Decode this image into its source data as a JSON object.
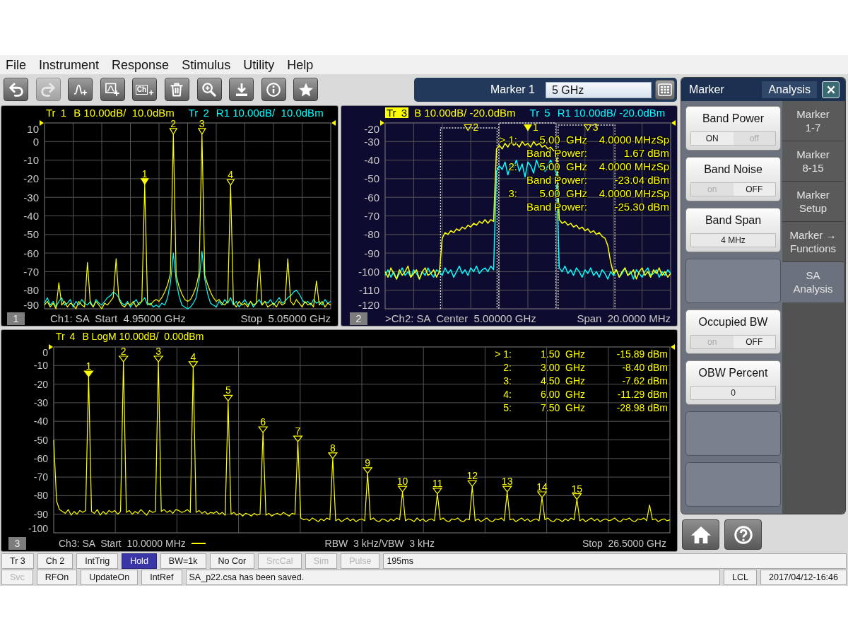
{
  "menu": [
    {
      "label": "File"
    },
    {
      "label": "Instrument"
    },
    {
      "label": "Response"
    },
    {
      "label": "Stimulus"
    },
    {
      "label": "Utility"
    },
    {
      "label": "Help"
    }
  ],
  "toolbar": [
    {
      "kind": "undo",
      "disabled": false
    },
    {
      "kind": "redo",
      "disabled": true
    },
    {
      "kind": "add-trace",
      "disabled": false
    },
    {
      "kind": "add-window",
      "disabled": false
    },
    {
      "kind": "add-channel",
      "text": "Ch",
      "disabled": false
    },
    {
      "kind": "delete",
      "disabled": false
    },
    {
      "kind": "zoom",
      "disabled": false
    },
    {
      "kind": "save",
      "disabled": false
    },
    {
      "kind": "info",
      "disabled": false
    },
    {
      "kind": "favorite",
      "disabled": false
    }
  ],
  "marker_entry": {
    "label": "Marker 1",
    "value": "5 GHz"
  },
  "windows": [
    {
      "number": "1",
      "active": false,
      "traces": [
        {
          "scale": "B 10.00dB/  10.0dBm",
          "selected": false
        },
        {
          "scale": "R1 10.00dB/  10.0dBm",
          "selected": false
        }
      ],
      "chart_data": {
        "type": "line",
        "grid": true,
        "ylim": [
          -90,
          10
        ],
        "yticks": [
          10,
          0,
          -10,
          -20,
          -30,
          -40,
          -50,
          -60,
          -70,
          -80,
          -90
        ],
        "categories": [
          null,
          null,
          null,
          null,
          null,
          null,
          null,
          null,
          null,
          null,
          null,
          null,
          null,
          null,
          null,
          null,
          null,
          null,
          null,
          null,
          null,
          null,
          null,
          null,
          null,
          null,
          null,
          null,
          null,
          null,
          null,
          null,
          null,
          null,
          null,
          null,
          null,
          null,
          null,
          null,
          null,
          null,
          null,
          null,
          null,
          null,
          null,
          null,
          null,
          null,
          null,
          null,
          null,
          null,
          null,
          null,
          null,
          null,
          null,
          null,
          null,
          null,
          null,
          null,
          null,
          null,
          null,
          null,
          null,
          null,
          null,
          null,
          null,
          null,
          null,
          null,
          null,
          null,
          null,
          null,
          null,
          null,
          null,
          null,
          null,
          null,
          null,
          null,
          null,
          null,
          null,
          null,
          null,
          null,
          null,
          null,
          null,
          null,
          null,
          null,
          null
        ],
        "series": [
          {
            "name": "Tr 1",
            "color": "#ffff00",
            "values": [
              -88,
              -86,
              -89,
              -87,
              -90,
              -76,
              -88,
              -86,
              -89,
              -87,
              -88,
              -90,
              -86,
              -88,
              -89,
              -65,
              -87,
              -89,
              -86,
              -88,
              -90,
              -87,
              -88,
              -86,
              -84,
              -63,
              -85,
              -88,
              -89,
              -87,
              -88,
              -86,
              -89,
              -87,
              -86,
              -23,
              -87,
              -88,
              -86,
              -85,
              -86,
              -84,
              -81,
              -77,
              -71,
              4,
              -72,
              -78,
              -82,
              -85,
              -86,
              -85,
              -82,
              -78,
              -71,
              4,
              -72,
              -77,
              -81,
              -84,
              -86,
              -85,
              -87,
              -88,
              -86,
              -23.5,
              -87,
              -89,
              -86,
              -88,
              -87,
              -89,
              -86,
              -88,
              -87,
              -63,
              -88,
              -86,
              -89,
              -88,
              -87,
              -89,
              -86,
              -88,
              -87,
              -63,
              -86,
              -88,
              -85,
              -87,
              -89,
              -86,
              -88,
              -87,
              -89,
              -75,
              -88,
              -86,
              -89,
              -87,
              -88
            ]
          },
          {
            "name": "Tr 2",
            "color": "#00ffff",
            "values": [
              -87,
              -84,
              -88,
              -86,
              -89,
              -86,
              -84,
              -88,
              -87,
              -85,
              -89,
              -86,
              -88,
              -85,
              -87,
              -88,
              -86,
              -89,
              -85,
              -87,
              -88,
              -86,
              -84,
              -83,
              -81,
              -82,
              -84,
              -87,
              -88,
              -86,
              -89,
              -87,
              -85,
              -88,
              -86,
              -84,
              -88,
              -87,
              -89,
              -88,
              -89,
              -87,
              -88,
              -84,
              -76,
              -60,
              -75,
              -83,
              -88,
              -89,
              -90,
              -89,
              -87,
              -84,
              -75,
              -59,
              -74,
              -82,
              -87,
              -88,
              -89,
              -86,
              -88,
              -85,
              -87,
              -84,
              -88,
              -86,
              -89,
              -87,
              -85,
              -88,
              -86,
              -89,
              -87,
              -85,
              -88,
              -86,
              -87,
              -85,
              -88,
              -86,
              -84,
              -87,
              -86,
              -84,
              -83,
              -81,
              -80,
              -82,
              -85,
              -87,
              -86,
              -88,
              -85,
              -87,
              -86,
              -88,
              -85,
              -87,
              -86
            ]
          }
        ]
      },
      "markers": [
        {
          "label": "1",
          "selected": true
        },
        {
          "label": "2",
          "selected": false
        },
        {
          "label": "3",
          "selected": false
        },
        {
          "label": "4",
          "selected": false
        }
      ],
      "footer": {
        "left": "Ch1: SA  Start  4.95000 GHz",
        "right": "Stop  5.05000 GHz"
      }
    },
    {
      "number": "2",
      "active": true,
      "traces": [
        {
          "scale": "B 10.00dB/ -20.0dBm",
          "selected": true
        },
        {
          "scale": "R1 10.00dB/ -20.0dBm",
          "selected": false
        }
      ],
      "chart_data": {
        "type": "line",
        "grid": true,
        "ylim": [
          -120,
          -20
        ],
        "yticks": [
          -20,
          -30,
          -40,
          -50,
          -60,
          -70,
          -80,
          -90,
          -100,
          -110,
          -120
        ],
        "categories": [
          null,
          null,
          null,
          null,
          null,
          null,
          null,
          null,
          null,
          null,
          null,
          null,
          null,
          null,
          null,
          null,
          null,
          null,
          null,
          null,
          null,
          null,
          null,
          null,
          null,
          null,
          null,
          null,
          null,
          null,
          null,
          null,
          null,
          null,
          null,
          null,
          null,
          null,
          null,
          null,
          null,
          null,
          null,
          null,
          null,
          null,
          null,
          null,
          null,
          null,
          null,
          null,
          null,
          null,
          null,
          null,
          null,
          null,
          null,
          null,
          null,
          null,
          null,
          null,
          null,
          null,
          null,
          null,
          null,
          null,
          null,
          null,
          null,
          null,
          null,
          null,
          null,
          null,
          null,
          null,
          null,
          null,
          null,
          null,
          null,
          null,
          null,
          null,
          null,
          null,
          null,
          null,
          null,
          null,
          null,
          null,
          null,
          null,
          null,
          null,
          null
        ],
        "series": [
          {
            "name": "Tr 3",
            "color": "#ffff00",
            "values": [
              -100,
              -103,
              -98,
              -101,
              -104,
              -99,
              -102,
              -100,
              -97,
              -103,
              -101,
              -99,
              -104,
              -100,
              -98,
              -102,
              -101,
              -99,
              -103,
              -100,
              -82,
              -79,
              -80,
              -78,
              -79,
              -77,
              -78,
              -76,
              -77,
              -75,
              -76,
              -74,
              -75,
              -73,
              -74,
              -72,
              -74,
              -72,
              -73,
              -34,
              -32,
              -34,
              -31,
              -33,
              -30,
              -32,
              -31,
              -33,
              -30,
              -32,
              -31,
              -33,
              -30,
              -32,
              -31,
              -33,
              -32,
              -34,
              -33,
              -35,
              -34,
              -72,
              -74,
              -73,
              -75,
              -74,
              -76,
              -75,
              -77,
              -76,
              -78,
              -77,
              -79,
              -78,
              -80,
              -79,
              -81,
              -82,
              -86,
              -95,
              -101,
              -99,
              -103,
              -100,
              -98,
              -102,
              -101,
              -99,
              -104,
              -100,
              -98,
              -102,
              -100,
              -103,
              -99,
              -101,
              -98,
              -102,
              -100,
              -103,
              -101
            ]
          },
          {
            "name": "Tr 5",
            "color": "#00ffff",
            "values": [
              -102,
              -99,
              -103,
              -100,
              -104,
              -101,
              -98,
              -102,
              -100,
              -103,
              -99,
              -101,
              -104,
              -100,
              -102,
              -98,
              -101,
              -103,
              -99,
              -100,
              -102,
              -98,
              -101,
              -99,
              -103,
              -100,
              -97,
              -101,
              -99,
              -102,
              -98,
              -100,
              -97,
              -101,
              -99,
              -98,
              -100,
              -97,
              -99,
              -46,
              -43,
              -45,
              -41,
              -48,
              -42,
              -44,
              -40,
              -46,
              -42,
              -49,
              -41,
              -43,
              -47,
              -40,
              -44,
              -42,
              -46,
              -43,
              -40,
              -44,
              -47,
              -98,
              -100,
              -97,
              -101,
              -99,
              -102,
              -98,
              -100,
              -103,
              -99,
              -101,
              -98,
              -102,
              -100,
              -103,
              -99,
              -101,
              -104,
              -100,
              -102,
              -99,
              -103,
              -101,
              -98,
              -102,
              -100,
              -104,
              -99,
              -101,
              -103,
              -100,
              -98,
              -102,
              -101,
              -99,
              -103,
              -100,
              -102,
              -99,
              -101
            ]
          }
        ]
      },
      "markers": [
        {
          "label": "2",
          "selected": false
        },
        {
          "label": "1",
          "selected": true
        },
        {
          "label": "3",
          "selected": false
        }
      ],
      "readouts": [
        {
          "kind": "marker",
          "label": "> 1:",
          "frequency": "5.00  GHz",
          "value": "4.0000 MHzSp"
        },
        {
          "kind": "result",
          "label": "Band Power:",
          "value": "1.67 dBm"
        },
        {
          "kind": "marker",
          "label": "2:",
          "frequency": "5.00  GHz",
          "value": "4.0000 MHzSp"
        },
        {
          "kind": "result",
          "label": "Band Power:",
          "value": "-23.04 dBm"
        },
        {
          "kind": "marker",
          "label": "3:",
          "frequency": "5.00  GHz",
          "value": "4.0000 MHzSp"
        },
        {
          "kind": "result",
          "label": "Band Power:",
          "value": "-25.30 dBm"
        }
      ],
      "footer": {
        "left": ">Ch2: SA  Center  5.00000 GHz",
        "right": "Span  20.0000 MHz"
      }
    },
    {
      "number": "3",
      "active": false,
      "traces": [
        {
          "scale": "B LogM 10.00dB/  0.00dBm",
          "selected": false
        }
      ],
      "chart_data": {
        "type": "line",
        "grid": true,
        "ylim": [
          -100,
          0
        ],
        "yticks": [
          0,
          -10,
          -20,
          -30,
          -40,
          -50,
          -60,
          -70,
          -80,
          -90,
          -100
        ],
        "categories": [
          null,
          null,
          null,
          null,
          null,
          null,
          null,
          null,
          null,
          null,
          null,
          null,
          null,
          null,
          null,
          null,
          null,
          null,
          null,
          null,
          null,
          null,
          null,
          null,
          null,
          null,
          null,
          null,
          null,
          null,
          null,
          null,
          null,
          null,
          null,
          null,
          null,
          null,
          null,
          null,
          null,
          null,
          null,
          null,
          null,
          null,
          null,
          null,
          null,
          null,
          null,
          null,
          null,
          null,
          null,
          null,
          null,
          null,
          null,
          null,
          null,
          null,
          null,
          null,
          null,
          null,
          null,
          null,
          null,
          null,
          null,
          null,
          null,
          null,
          null,
          null,
          null,
          null,
          null,
          null,
          null,
          null,
          null,
          null,
          null,
          null,
          null,
          null,
          null,
          null,
          null,
          null,
          null,
          null,
          null,
          null,
          null,
          null,
          null,
          null,
          null,
          null,
          null,
          null,
          null,
          null,
          null,
          null,
          null,
          null,
          null,
          null,
          null,
          null,
          null,
          null,
          null,
          null,
          null,
          null,
          null,
          null,
          null,
          null,
          null,
          null,
          null,
          null,
          null,
          null,
          null,
          null,
          null,
          null,
          null,
          null,
          null,
          null,
          null,
          null,
          null,
          null,
          null,
          null,
          null,
          null,
          null,
          null,
          null,
          null,
          null,
          null,
          null,
          null,
          null,
          null,
          null,
          null,
          null,
          null,
          null,
          null,
          null,
          null,
          null,
          null,
          null,
          null,
          null,
          null,
          null,
          null,
          null,
          null,
          null,
          null,
          null,
          null,
          null,
          null,
          null,
          null,
          null,
          null,
          null,
          null,
          null,
          null,
          null,
          null,
          null,
          null,
          null,
          null,
          null,
          null,
          null,
          null,
          null,
          null,
          null,
          null,
          null,
          null,
          null,
          null,
          null,
          null,
          null,
          null,
          null,
          null,
          null
        ],
        "series": [
          {
            "name": "Tr 4",
            "color": "#ffff00",
            "values": [
              -50,
              -83,
              -87.5,
              -88.5,
              -89.5,
              -87.5,
              -90.5,
              -88.5,
              -90,
              -88,
              -89,
              -88,
              -16,
              -88.5,
              -89.5,
              -87.5,
              -90.5,
              -88.5,
              -90,
              -88,
              -89,
              -88,
              -90,
              -88.5,
              -8,
              -89,
              -88,
              -90,
              -88.5,
              -89.5,
              -87.5,
              -89,
              -90.5,
              -88,
              -89,
              -88.5,
              -8,
              -88.5,
              -87.5,
              -89,
              -88,
              -89.5,
              -87.5,
              -88,
              -89,
              -88.5,
              -87.5,
              -89,
              -11,
              -89,
              -88,
              -89.5,
              -88.5,
              -90,
              -89,
              -89.5,
              -88.5,
              -90,
              -89,
              -90.5,
              -29,
              -90,
              -89,
              -90.5,
              -89.5,
              -91,
              -89.5,
              -90,
              -91,
              -89.5,
              -90.5,
              -90,
              -46,
              -90.5,
              -89.5,
              -91,
              -90,
              -89.5,
              -90.5,
              -89,
              -90,
              -91,
              -89.5,
              -90,
              -51,
              -92,
              -93,
              -92.5,
              -93.5,
              -92,
              -93,
              -94,
              -92.5,
              -93.5,
              -92,
              -93,
              -60,
              -93.5,
              -92.5,
              -94,
              -93,
              -92,
              -93.5,
              -92.5,
              -94,
              -93,
              -92.5,
              -93.5,
              -68,
              -93,
              -92,
              -93.5,
              -94,
              -92.5,
              -93,
              -94,
              -92.5,
              -93.5,
              -92,
              -93,
              -78,
              -93.5,
              -92.5,
              -93,
              -94,
              -92,
              -93.5,
              -92.5,
              -94,
              -93,
              -92.5,
              -93.5,
              -79,
              -93,
              -92,
              -93.5,
              -94,
              -92.5,
              -93,
              -92,
              -93.5,
              -94,
              -92.5,
              -93,
              -75,
              -93.5,
              -92.5,
              -94,
              -93,
              -92,
              -93.5,
              -94,
              -92.5,
              -93,
              -92,
              -93.5,
              -78,
              -93,
              -92.5,
              -94,
              -93,
              -92,
              -93.5,
              -92.5,
              -94,
              -93,
              -92.5,
              -93.5,
              -81,
              -93,
              -92,
              -93.5,
              -94,
              -92.5,
              -93,
              -94,
              -92.5,
              -93.5,
              -92,
              -93,
              -82,
              -93.5,
              -92.5,
              -94,
              -93,
              -92,
              -93.5,
              -92.5,
              -94,
              -93,
              -92.5,
              -93.5,
              -93,
              -92,
              -93.5,
              -94,
              -92.5,
              -93,
              -92,
              -93.5,
              -94,
              -92.5,
              -93,
              -92,
              -93.5,
              -85,
              -93,
              -92.5,
              -94,
              -93,
              -92.5,
              -93.5,
              -93
            ]
          }
        ]
      },
      "markers": [
        {
          "label": "1",
          "selected": true
        },
        {
          "label": "2",
          "selected": false
        },
        {
          "label": "3",
          "selected": false
        },
        {
          "label": "4",
          "selected": false
        },
        {
          "label": "5",
          "selected": false
        },
        {
          "label": "6",
          "selected": false
        },
        {
          "label": "7",
          "selected": false
        },
        {
          "label": "8",
          "selected": false
        },
        {
          "label": "9",
          "selected": false
        },
        {
          "label": "10",
          "selected": false
        },
        {
          "label": "11",
          "selected": false
        },
        {
          "label": "12",
          "selected": false
        },
        {
          "label": "13",
          "selected": false
        },
        {
          "label": "14",
          "selected": false
        },
        {
          "label": "15",
          "selected": false
        }
      ],
      "readouts": [
        {
          "kind": "marker",
          "label": "> 1:",
          "frequency": "1.50  GHz",
          "value": "-15.89 dBm"
        },
        {
          "kind": "marker",
          "label": "2:",
          "frequency": "3.00  GHz",
          "value": "-8.40 dBm"
        },
        {
          "kind": "marker",
          "label": "3:",
          "frequency": "4.50  GHz",
          "value": "-7.62 dBm"
        },
        {
          "kind": "marker",
          "label": "4:",
          "frequency": "6.00  GHz",
          "value": "-11.29 dBm"
        },
        {
          "kind": "marker",
          "label": "5:",
          "frequency": "7.50  GHz",
          "value": "-28.98 dBm"
        }
      ],
      "footer": {
        "left": "Ch3: SA  Start  10.0000 MHz",
        "legend": true,
        "center": "RBW  3 kHz/VBW  3 kHz",
        "right": "Stop  26.5000 GHz"
      }
    }
  ],
  "side_panel": {
    "title": "Marker",
    "section": "Analysis",
    "softkeys": [
      {
        "kind": "toggle",
        "label": "Band Power",
        "on_text": "ON",
        "off_text": "off",
        "on": true
      },
      {
        "kind": "toggle",
        "label": "Band Noise",
        "on_text": "on",
        "off_text": "OFF",
        "on": false
      },
      {
        "kind": "value",
        "label": "Band Span",
        "value": "4 MHz"
      },
      {
        "kind": "empty"
      },
      {
        "kind": "toggle",
        "label": "Occupied BW",
        "on_text": "on",
        "off_text": "OFF",
        "on": false
      },
      {
        "kind": "value",
        "label": "OBW Percent",
        "value": "0"
      },
      {
        "kind": "empty"
      },
      {
        "kind": "empty"
      }
    ],
    "tabs": [
      {
        "label": "Marker\n1-7",
        "selected": false
      },
      {
        "label": "Marker\n8-15",
        "selected": false
      },
      {
        "label": "Marker\nSetup",
        "selected": false
      },
      {
        "label": "Marker →\nFunctions",
        "selected": false
      },
      {
        "label": "SA\nAnalysis",
        "selected": true
      }
    ]
  },
  "status_bar": {
    "row_1": {
      "items": [
        {
          "text": "Tr 3",
          "active": false,
          "disabled": false
        },
        {
          "text": "Ch 2",
          "active": false,
          "disabled": false
        },
        {
          "text": "IntTrig",
          "active": false,
          "disabled": false
        },
        {
          "text": "Hold",
          "active": true,
          "disabled": false
        },
        {
          "text": "BW=1k",
          "active": false,
          "disabled": false
        },
        {
          "text": "No Cor",
          "active": false,
          "disabled": false
        },
        {
          "text": "SrcCal",
          "active": false,
          "disabled": true
        },
        {
          "text": "Sim",
          "active": false,
          "disabled": true
        },
        {
          "text": "Pulse",
          "active": false,
          "disabled": true
        }
      ],
      "readout": "195ms"
    },
    "row_2": {
      "items": [
        {
          "text": "Svc",
          "disabled": true
        },
        {
          "text": "RFOn",
          "disabled": false
        },
        {
          "text": "UpdateOn",
          "disabled": false
        },
        {
          "text": "IntRef",
          "disabled": false
        }
      ],
      "message": "SA_p22.csa has been saved.",
      "right": [
        {
          "text": "LCL"
        },
        {
          "text": "2017/04/12-16:46"
        }
      ]
    }
  }
}
